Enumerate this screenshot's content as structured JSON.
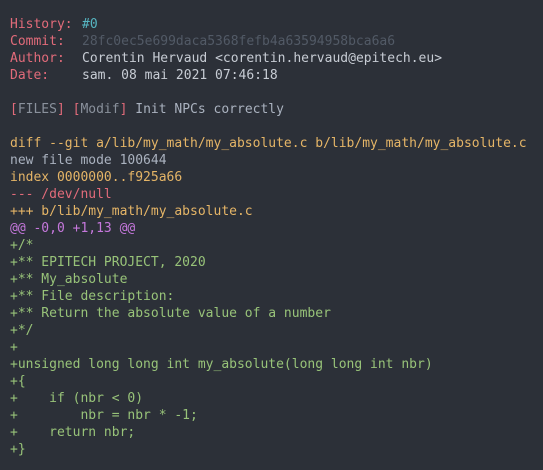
{
  "commit_header": {
    "history_label": "History:",
    "history_value": "#0",
    "commit_label": "Commit:",
    "commit_value": "28fc0ec5e699daca5368fefb4a63594958bca6a6",
    "author_label": "Author:",
    "author_name": "Corentin Hervaud",
    "author_email": "<corentin.hervaud@epitech.eu>",
    "date_label": "Date:",
    "date_value": "sam. 08 mai 2021 07:46:18"
  },
  "subject_line": {
    "tag1_open": "[",
    "tag1": "FILES",
    "tag1_close": "]",
    "tag2_open": "[",
    "tag2": "Modif",
    "tag2_close": "]",
    "message": "Init NPCs correctly"
  },
  "diff": {
    "diff_line": "diff --git a/lib/my_math/my_absolute.c b/lib/my_math/my_absolute.c",
    "mode_line": "new file mode 100644",
    "index_line": "index 0000000..f925a66",
    "minus_file": "--- /dev/null",
    "plus_file": "+++ b/lib/my_math/my_absolute.c",
    "hunk_header": "@@ -0,0 +1,13 @@",
    "added_lines": [
      "+/*",
      "+** EPITECH PROJECT, 2020",
      "+** My_absolute",
      "+** File description:",
      "+** Return the absolute value of a number",
      "+*/",
      "+",
      "+unsigned long long int my_absolute(long long int nbr)",
      "+{",
      "+    if (nbr < 0)",
      "+        nbr = nbr * -1;",
      "+    return nbr;",
      "+}"
    ]
  },
  "colors": {
    "background": "#2c3038",
    "label": "#e26b7a",
    "history": "#56b6c2",
    "diff_header": "#e5b567",
    "hunk": "#c678dd",
    "added": "#98c379"
  }
}
